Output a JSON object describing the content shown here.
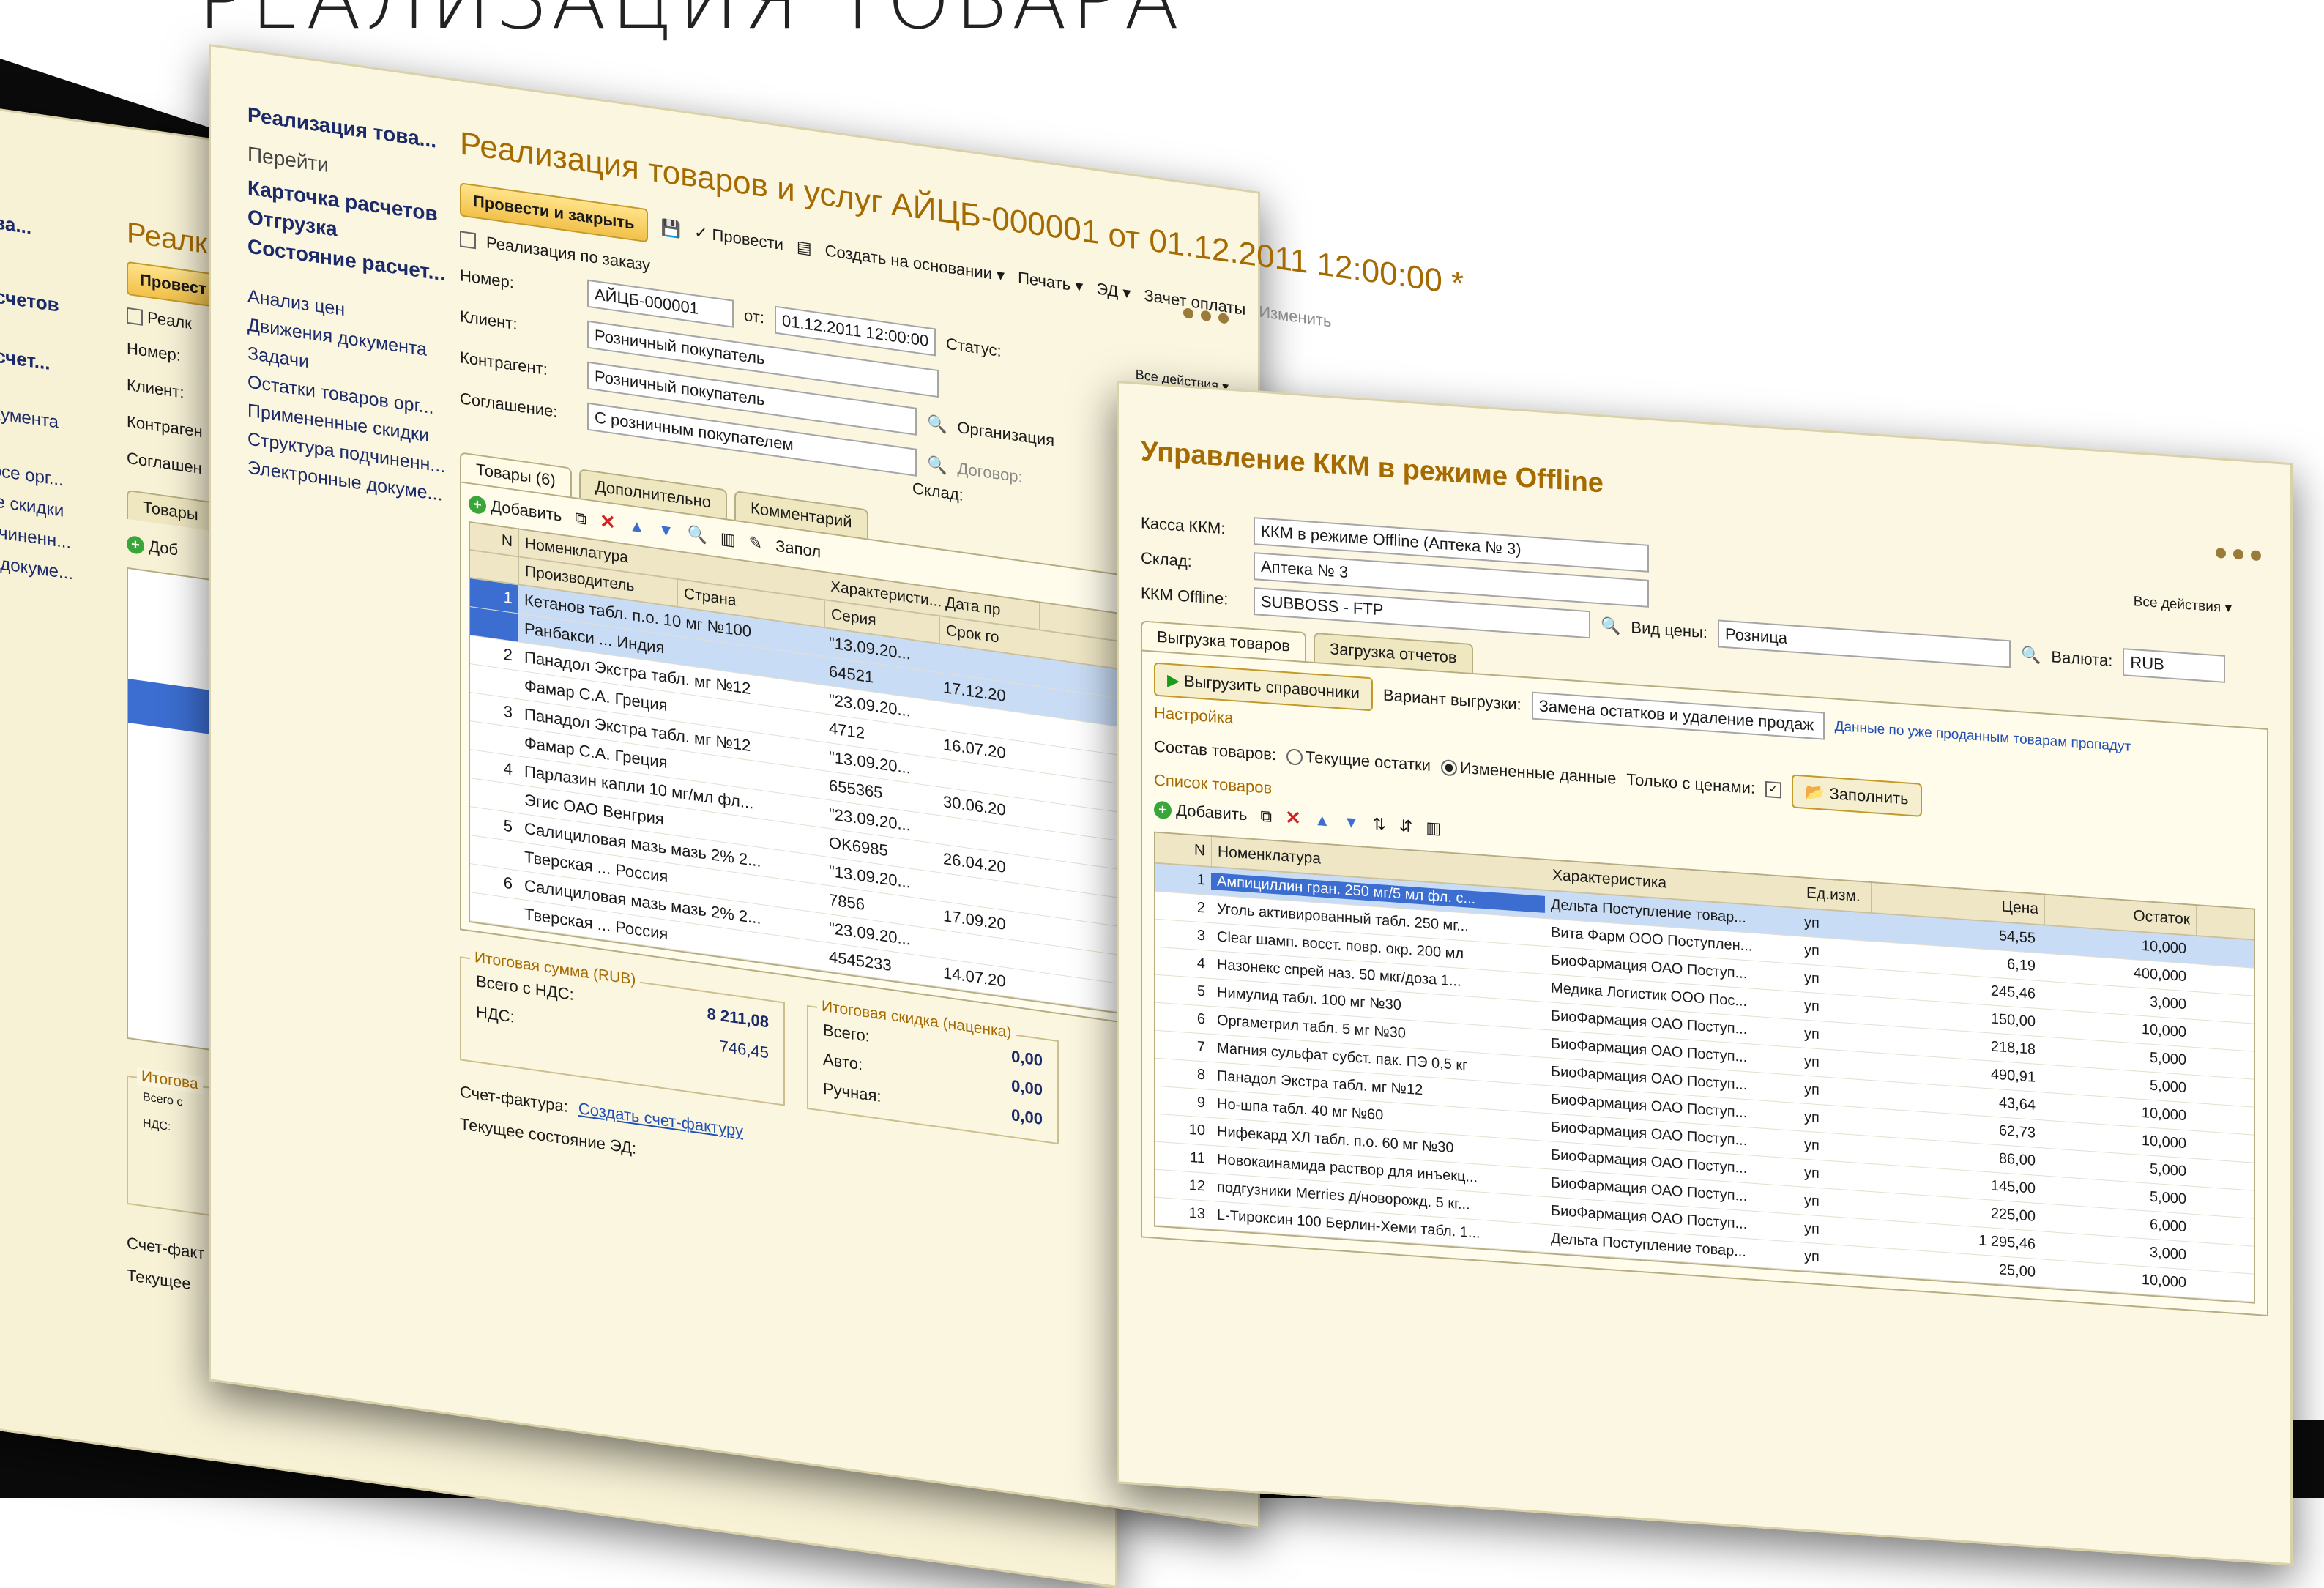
{
  "hero_title": "РЕАЛИЗАЦИЯ ТОВАРА",
  "win1": {
    "title_prefix": "Реалк",
    "sidebar": [
      "това...",
      "расчетов",
      "расчет...",
      "документа",
      "ворсе орг...",
      "ные скидки",
      "годчиненн...",
      "ые докуме..."
    ],
    "fields": [
      "Номер:",
      "Клиент:",
      "Контраген",
      "Соглашен"
    ],
    "button": "Провест",
    "checkbox": "Реалк",
    "tab": "Товары",
    "add": "Доб",
    "totals_legend": "Итогова",
    "total_label": "Всего с",
    "vat_label": "НДС:",
    "invoice_label": "Счет-факт",
    "state_label": "Текущее"
  },
  "win2": {
    "sidebar_title": "Реализация това...",
    "go_label": "Перейти",
    "nav": [
      "Карточка расчетов",
      "Отгрузка",
      "Состояние расчет..."
    ],
    "sub": [
      "Анализ цен",
      "Движения документа",
      "Задачи",
      "Остатки товаров орг...",
      "Примененные скидки",
      "Структура подчиненн...",
      "Электронные докуме..."
    ],
    "title": "Реализация товаров и услуг АЙЦБ-000001 от 01.12.2011 12:00:00 *",
    "toolbar": {
      "post_close": "Провести и закрыть",
      "post": "Провести",
      "create_based": "Создать на основании ▾",
      "print": "Печать ▾",
      "ed": "ЭД ▾",
      "pay": "Зачет оплаты",
      "edit": "Изменить",
      "all_actions": "Все действия ▾"
    },
    "by_order": "Реализация по заказу",
    "number_label": "Номер:",
    "number_value": "АЙЦБ-000001",
    "from_label": "от:",
    "date_value": "01.12.2011 12:00:00",
    "status_label": "Статус:",
    "client_label": "Клиент:",
    "client_value": "Розничный покупатель",
    "counterparty_label": "Контрагент:",
    "counterparty_value": "Розничный покупатель",
    "org_label": "Организация",
    "agreement_label": "Соглашение:",
    "agreement_value": "С розничным покупателем",
    "contract_label": "Договор:",
    "warehouse_label": "Склад:",
    "tabs": [
      "Товары (6)",
      "Дополнительно",
      "Комментарий"
    ],
    "add_label": "Добавить",
    "fill_label": "Запол",
    "columns": [
      "N",
      "Номенклатура",
      "Характеристи...",
      "Дата пр"
    ],
    "sub_columns": [
      "Производитель",
      "Страна",
      "Серия",
      "Срок го"
    ],
    "rows": [
      {
        "n": "1",
        "name": "Кетанов табл. п.о. 10 мг №100",
        "ser": "\"13.09.20...",
        "date": ""
      },
      {
        "n": "",
        "name": "Ранбакси ...      Индия",
        "ser": "64521",
        "date": "17.12.20"
      },
      {
        "n": "2",
        "name": "Панадол Экстра табл. мг №12",
        "ser": "\"23.09.20...",
        "date": ""
      },
      {
        "n": "",
        "name": "Фамар С.А.      Греция",
        "ser": "4712",
        "date": "16.07.20"
      },
      {
        "n": "3",
        "name": "Панадол Экстра табл. мг №12",
        "ser": "\"13.09.20...",
        "date": ""
      },
      {
        "n": "",
        "name": "Фамар С.А.      Греция",
        "ser": "655365",
        "date": "30.06.20"
      },
      {
        "n": "4",
        "name": "Парлазин капли 10 мг/мл фл...",
        "ser": "\"23.09.20...",
        "date": ""
      },
      {
        "n": "",
        "name": "Эгис ОАО        Венгрия",
        "ser": "OK6985",
        "date": "26.04.20"
      },
      {
        "n": "5",
        "name": "Салициловая мазь мазь 2% 2...",
        "ser": "\"13.09.20...",
        "date": ""
      },
      {
        "n": "",
        "name": "Тверская ...    Россия",
        "ser": "7856",
        "date": "17.09.20"
      },
      {
        "n": "6",
        "name": "Салициловая мазь мазь 2% 2...",
        "ser": "\"23.09.20...",
        "date": ""
      },
      {
        "n": "",
        "name": "Тверская ...    Россия",
        "ser": "4545233",
        "date": "14.07.20"
      }
    ],
    "total_legend": "Итоговая сумма (RUB)",
    "total_vat_label": "Всего с НДС:",
    "total_vat_value": "8 211,08",
    "vat_label": "НДС:",
    "vat_value": "746,45",
    "discount_legend": "Итоговая скидка (наценка)",
    "disc_rows": [
      {
        "label": "Всего:",
        "value": "0,00"
      },
      {
        "label": "Авто:",
        "value": "0,00"
      },
      {
        "label": "Ручная:",
        "value": "0,00"
      }
    ],
    "invoice_label": "Счет-фактура:",
    "invoice_link": "Создать счет-фактуру",
    "ed_state_label": "Текущее состояние ЭД:"
  },
  "win3": {
    "title": "Управление ККМ в режиме Offline",
    "all_actions": "Все действия ▾",
    "kkm_label": "Касса ККМ:",
    "kkm_value": "ККМ в режиме Offline (Аптека № 3)",
    "warehouse_label": "Склад:",
    "warehouse_value": "Аптека № 3",
    "offline_label": "ККМ Offline:",
    "offline_value": "SUBBOSS - FTP",
    "price_kind_label": "Вид цены:",
    "price_kind_value": "Розница",
    "currency_label": "Валюта:",
    "currency_value": "RUB",
    "tabs": [
      "Выгрузка товаров",
      "Загрузка отчетов"
    ],
    "upload_button": "Выгрузить справочники",
    "variant_label": "Вариант выгрузки:",
    "variant_value": "Замена остатков и удаление продаж",
    "variant_note": "Данные по уже проданным товарам пропадут",
    "settings_label": "Настройка",
    "composition_label": "Состав товаров:",
    "radio_current": "Текущие остатки",
    "radio_changed": "Измененные данные",
    "only_prices_label": "Только с ценами:",
    "fill_button": "Заполнить",
    "list_label": "Список товаров",
    "add_label": "Добавить",
    "columns": [
      "N",
      "Номенклатура",
      "Характеристика",
      "Ед.изм.",
      "Цена",
      "Остаток"
    ],
    "rows": [
      {
        "n": "1",
        "name": "Ампициллин гран. 250 мг/5 мл фл. с...",
        "ch": "Дельта Поступление товар...",
        "u": "уп",
        "p": "54,55",
        "o": "10,000"
      },
      {
        "n": "2",
        "name": "Уголь активированный табл. 250 мг...",
        "ch": "Вита Фарм ООО Поступлен...",
        "u": "уп",
        "p": "6,19",
        "o": "400,000"
      },
      {
        "n": "3",
        "name": "Clear шамп. восст. повр. окр. 200 мл",
        "ch": "БиоФармация ОАО Поступ...",
        "u": "уп",
        "p": "245,46",
        "o": "3,000"
      },
      {
        "n": "4",
        "name": "Назонекс спрей наз. 50 мкг/доза 1...",
        "ch": "Медика Логистик ООО Пос...",
        "u": "уп",
        "p": "150,00",
        "o": "10,000"
      },
      {
        "n": "5",
        "name": "Нимулид табл. 100 мг №30",
        "ch": "БиоФармация ОАО Поступ...",
        "u": "уп",
        "p": "218,18",
        "o": "5,000"
      },
      {
        "n": "6",
        "name": "Оргаметрил табл. 5 мг №30",
        "ch": "БиоФармация ОАО Поступ...",
        "u": "уп",
        "p": "490,91",
        "o": "5,000"
      },
      {
        "n": "7",
        "name": "Магния сульфат субст. пак. ПЭ 0,5 кг",
        "ch": "БиоФармация ОАО Поступ...",
        "u": "уп",
        "p": "43,64",
        "o": "10,000"
      },
      {
        "n": "8",
        "name": "Панадол Экстра табл. мг №12",
        "ch": "БиоФармация ОАО Поступ...",
        "u": "уп",
        "p": "62,73",
        "o": "10,000"
      },
      {
        "n": "9",
        "name": "Но-шпа табл. 40 мг №60",
        "ch": "БиоФармация ОАО Поступ...",
        "u": "уп",
        "p": "86,00",
        "o": "5,000"
      },
      {
        "n": "10",
        "name": "Нифекард ХЛ табл. п.о. 60 мг №30",
        "ch": "БиоФармация ОАО Поступ...",
        "u": "уп",
        "p": "145,00",
        "o": "5,000"
      },
      {
        "n": "11",
        "name": "Новокаинамида раствор для инъекц...",
        "ch": "БиоФармация ОАО Поступ...",
        "u": "уп",
        "p": "225,00",
        "o": "6,000"
      },
      {
        "n": "12",
        "name": "подгузники Merries д/новорожд. 5 кг...",
        "ch": "БиоФармация ОАО Поступ...",
        "u": "уп",
        "p": "1 295,46",
        "o": "3,000"
      },
      {
        "n": "13",
        "name": "L-Тироксин 100 Берлин-Хеми табл. 1...",
        "ch": "Дельта Поступление товар...",
        "u": "уп",
        "p": "25,00",
        "o": "10,000"
      }
    ]
  }
}
